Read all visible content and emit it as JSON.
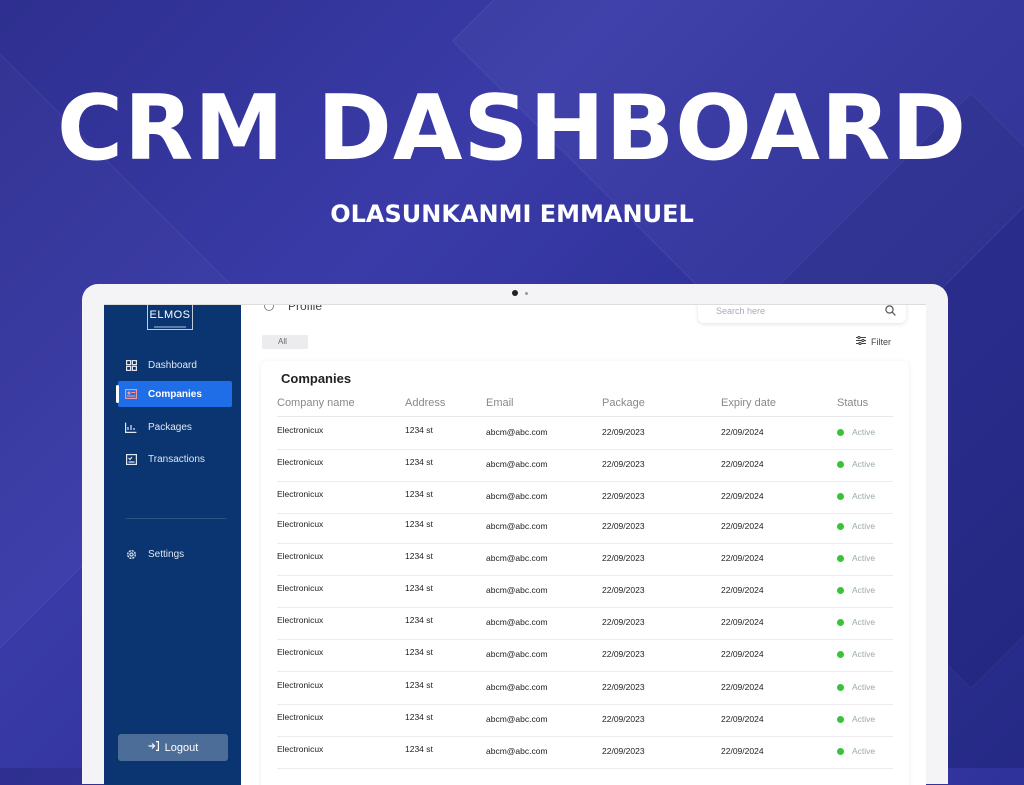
{
  "hero": {
    "title": "CRM DASHBOARD",
    "subtitle": "OLASUNKANMI EMMANUEL"
  },
  "app": {
    "logo": "ELMOS",
    "nav": [
      {
        "label": "Dashboard",
        "icon": "grid-icon"
      },
      {
        "label": "Companies",
        "icon": "id-card-icon",
        "active": true
      },
      {
        "label": "Packages",
        "icon": "chart-icon"
      },
      {
        "label": "Transactions",
        "icon": "checklist-icon"
      }
    ],
    "settings_label": "Settings",
    "logout_label": "Logout"
  },
  "topbar": {
    "profile_label": "Profile",
    "search_placeholder": "Search here",
    "chip_label": "All",
    "filter_label": "Filter"
  },
  "table": {
    "title": "Companies",
    "columns": [
      "Company name",
      "Address",
      "Email",
      "Package",
      "Expiry date",
      "Status"
    ],
    "rows": [
      [
        "Electronicux",
        "1234 st",
        "abcm@abc.com",
        "22/09/2023",
        "22/09/2024",
        "Active"
      ],
      [
        "Electronicux",
        "1234 st",
        "abcm@abc.com",
        "22/09/2023",
        "22/09/2024",
        "Active"
      ],
      [
        "Electronicux",
        "1234 st",
        "abcm@abc.com",
        "22/09/2023",
        "22/09/2024",
        "Active"
      ],
      [
        "Electronicux",
        "1234 st",
        "abcm@abc.com",
        "22/09/2023",
        "22/09/2024",
        "Active"
      ],
      [
        "Electronicux",
        "1234 st",
        "abcm@abc.com",
        "22/09/2023",
        "22/09/2024",
        "Active"
      ],
      [
        "Electronicux",
        "1234 st",
        "abcm@abc.com",
        "22/09/2023",
        "22/09/2024",
        "Active"
      ],
      [
        "Electronicux",
        "1234 st",
        "abcm@abc.com",
        "22/09/2023",
        "22/09/2024",
        "Active"
      ],
      [
        "Electronicux",
        "1234 st",
        "abcm@abc.com",
        "22/09/2023",
        "22/09/2024",
        "Active"
      ],
      [
        "Electronicux",
        "1234 st",
        "abcm@abc.com",
        "22/09/2023",
        "22/09/2024",
        "Active"
      ],
      [
        "Electronicux",
        "1234 st",
        "abcm@abc.com",
        "22/09/2023",
        "22/09/2024",
        "Active"
      ],
      [
        "Electronicux",
        "1234 st",
        "abcm@abc.com",
        "22/09/2023",
        "22/09/2024",
        "Active"
      ]
    ]
  },
  "colors": {
    "background": "#3a3ba8",
    "sidebar": "#0b3570",
    "accent": "#1f6ee8",
    "active_status": "#3ac23a"
  }
}
